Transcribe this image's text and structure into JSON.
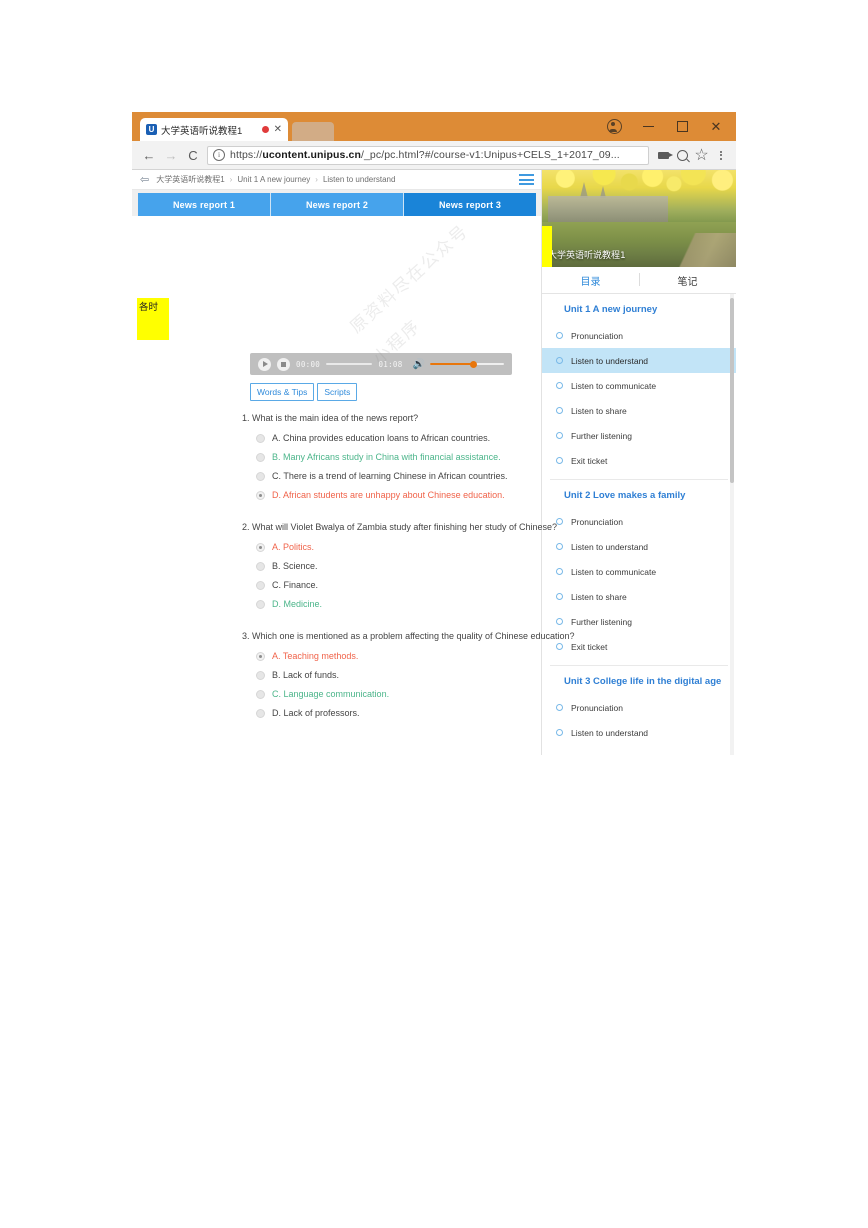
{
  "browser": {
    "tab": {
      "title": "大学英语听说教程1",
      "logo": "U",
      "recording_icon": "record-dot",
      "close_icon": "close-icon"
    },
    "window_controls": {
      "profile": "profile-avatar",
      "minimize": "–",
      "maximize": "□",
      "close": "✕"
    },
    "toolbar": {
      "back": "←",
      "forward": "→",
      "reload": "C",
      "info_icon": "ⓘ",
      "url_prefix": "https://",
      "url_domain": "ucontent.unipus.cn",
      "url_path": "/_pc/pc.html?#/course-v1:Unipus+CELS_1+2017_09...",
      "cast_icon": "cast-icon",
      "zoom_icon": "zoom-out-icon",
      "bookmark_icon": "star-icon",
      "menu_icon": "three-dots-icon"
    }
  },
  "page": {
    "breadcrumb": {
      "back_icon": "back-arrow-icon",
      "items": [
        "大学英语听说教程1",
        "Unit 1 A new journey",
        "Listen to understand"
      ],
      "separator": "›",
      "menu_icon": "hamburger-icon"
    },
    "report_tabs": [
      {
        "label": "News report 1",
        "active": false
      },
      {
        "label": "News report 2",
        "active": false
      },
      {
        "label": "News report 3",
        "active": true
      }
    ],
    "sticky_note": "各时",
    "watermark": "原资料尽在公众号",
    "watermark2": "小程序",
    "player": {
      "play_icon": "play-icon",
      "stop_icon": "stop-icon",
      "current_time": "00:00",
      "total_time": "01:08",
      "volume_icon": "volume-icon",
      "volume_color": "#e8760c"
    },
    "action_buttons": [
      {
        "label": "Words & Tips"
      },
      {
        "label": "Scripts"
      }
    ],
    "questions": [
      {
        "number": "1.",
        "text": "1. What is the main idea of the news report?",
        "options": [
          {
            "label": "A. China provides education loans to African countries.",
            "state": "normal",
            "selected": false
          },
          {
            "label": "B. Many Africans study in China with financial assistance.",
            "state": "right",
            "selected": false
          },
          {
            "label": "C. There is a trend of learning Chinese in African countries.",
            "state": "normal",
            "selected": false
          },
          {
            "label": "D. African students are unhappy about Chinese education.",
            "state": "wrong",
            "selected": true
          }
        ]
      },
      {
        "number": "2.",
        "text": "2. What will Violet Bwalya of Zambia study after finishing her study of Chinese?",
        "options": [
          {
            "label": "A. Politics.",
            "state": "wrong",
            "selected": true
          },
          {
            "label": "B. Science.",
            "state": "normal",
            "selected": false
          },
          {
            "label": "C. Finance.",
            "state": "normal",
            "selected": false
          },
          {
            "label": "D. Medicine.",
            "state": "right",
            "selected": false
          }
        ]
      },
      {
        "number": "3.",
        "text": "3. Which one is mentioned as a problem affecting the quality of Chinese education?",
        "options": [
          {
            "label": "A. Teaching methods.",
            "state": "wrong",
            "selected": true
          },
          {
            "label": "B. Lack of funds.",
            "state": "normal",
            "selected": false
          },
          {
            "label": "C. Language communication.",
            "state": "right",
            "selected": false
          },
          {
            "label": "D. Lack of professors.",
            "state": "normal",
            "selected": false
          }
        ]
      }
    ]
  },
  "sidebar": {
    "hero_caption": "大学英语听说教程1",
    "tabs": [
      {
        "label": "目录",
        "active": true
      },
      {
        "label": "笔记",
        "active": false
      }
    ],
    "units": [
      {
        "title": "Unit 1 A new journey",
        "items": [
          {
            "label": "Pronunciation",
            "active": false
          },
          {
            "label": "Listen to understand",
            "active": true
          },
          {
            "label": "Listen to communicate",
            "active": false
          },
          {
            "label": "Listen to share",
            "active": false
          },
          {
            "label": "Further listening",
            "active": false
          },
          {
            "label": "Exit ticket",
            "active": false
          }
        ]
      },
      {
        "title": "Unit 2 Love makes a family",
        "items": [
          {
            "label": "Pronunciation",
            "active": false
          },
          {
            "label": "Listen to understand",
            "active": false
          },
          {
            "label": "Listen to communicate",
            "active": false
          },
          {
            "label": "Listen to share",
            "active": false
          },
          {
            "label": "Further listening",
            "active": false
          },
          {
            "label": "Exit ticket",
            "active": false
          }
        ]
      },
      {
        "title": "Unit 3 College life in the digital age",
        "items": [
          {
            "label": "Pronunciation",
            "active": false
          },
          {
            "label": "Listen to understand",
            "active": false
          }
        ]
      }
    ]
  },
  "colors": {
    "browser_accent": "#dd8b36",
    "tab_blue": "#46a3ec",
    "tab_blue_active": "#1a84d8",
    "link_blue": "#2f8ada",
    "wrong": "#f0634a",
    "right": "#4bb58a",
    "highlight": "#c2e4f7",
    "sticky": "#ffff00"
  }
}
